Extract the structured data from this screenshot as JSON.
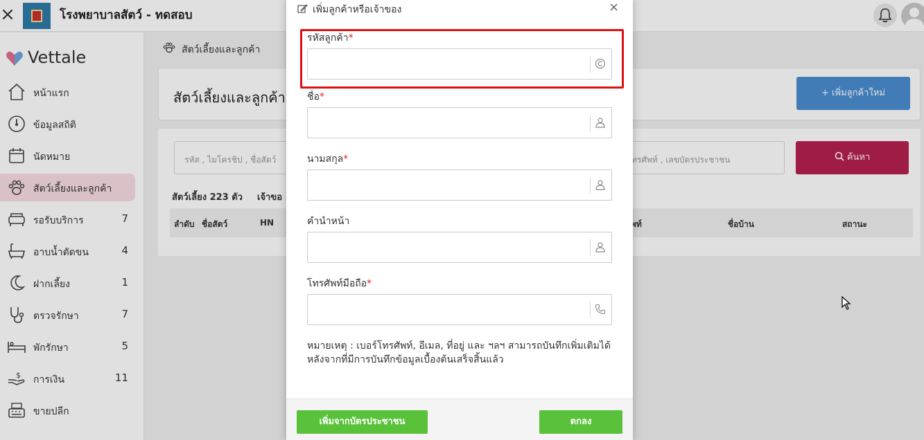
{
  "app": {
    "title": "โรงพยาบาลสัตว์ - ทดสอบ",
    "brand": "Vettale"
  },
  "sidebar": {
    "items": [
      {
        "label": "หน้าแรก",
        "icon": "home-icon",
        "count": ""
      },
      {
        "label": "ข้อมูลสถิติ",
        "icon": "dashboard-gauge-icon",
        "count": ""
      },
      {
        "label": "นัดหมาย",
        "icon": "calendar-icon",
        "count": ""
      },
      {
        "label": "สัตว์เลี้ยงและลูกค้า",
        "icon": "paw-icon",
        "count": "",
        "active": true
      },
      {
        "label": "รอรับบริการ",
        "icon": "sofa-icon",
        "count": "7"
      },
      {
        "label": "อาบน้ำตัดขน",
        "icon": "bathtub-icon",
        "count": "4"
      },
      {
        "label": "ฝากเลี้ยง",
        "icon": "moon-icon",
        "count": "1"
      },
      {
        "label": "ตรวจรักษา",
        "icon": "stethoscope-icon",
        "count": "7"
      },
      {
        "label": "พักรักษา",
        "icon": "bed-icon",
        "count": "5"
      },
      {
        "label": "การเงิน",
        "icon": "hand-money-icon",
        "count": "11"
      },
      {
        "label": "ขายปลีก",
        "icon": "cash-register-icon",
        "count": ""
      }
    ]
  },
  "main": {
    "breadcrumb": "สัตว์เลี้ยงและลูกค้า",
    "page_title": "สัตว์เลี้ยงและลูกค้า",
    "add_customer_button": "+ เพิ่มลูกค้าใหม่",
    "search_placeholder_left": "รหัส , ไมโครชิป , ชื่อสัตว์",
    "search_placeholder_right": "ทรศัพท์ , เลขบัตรประชาชน",
    "search_button": "ค้นหา",
    "pet_count": "สัตว์เลี้ยง 223 ตัว",
    "owner_count_partial": "เจ้าขอ",
    "table_headers": [
      "ลำดับ",
      "ชื่อสัตว์",
      "HN",
      "พท์",
      "ชื่อบ้าน",
      "สถานะ"
    ]
  },
  "modal": {
    "title": "เพิ่มลูกค้าหรือเจ้าของ",
    "close": "×",
    "fields": [
      {
        "label": "รหัสลูกค้า",
        "required": "*",
        "value": "",
        "icon": "copyright-icon"
      },
      {
        "label": "ชื่อ",
        "required": "*",
        "value": "",
        "icon": "user-icon"
      },
      {
        "label": "นามสกุล",
        "required": "*",
        "value": "",
        "icon": "user-icon"
      },
      {
        "label": "คำนำหน้า",
        "required": "",
        "value": "",
        "icon": "user-icon"
      },
      {
        "label": "โทรศัพท์มือถือ",
        "required": "*",
        "value": "",
        "icon": "phone-icon"
      }
    ],
    "note": "หมายเหตุ : เบอร์โทรศัพท์, อีเมล, ที่อยู่ และ ฯลฯ สามารถบันทึกเพิ่มเติมได้หลังจากที่มีการบันทึกข้อมูลเบื้องต้นเสร็จสิ้นแล้ว",
    "add_from_id_card_button": "เพิ่มจากบัตรประชาชน",
    "ok_button": "ตกลง"
  },
  "colors": {
    "accent_blue": "#4a8ed1",
    "search_crimson": "#b6204f",
    "confirm_green": "#5ac23a",
    "highlight_red": "#e01010",
    "active_nav_pink": "#f7dce3"
  }
}
